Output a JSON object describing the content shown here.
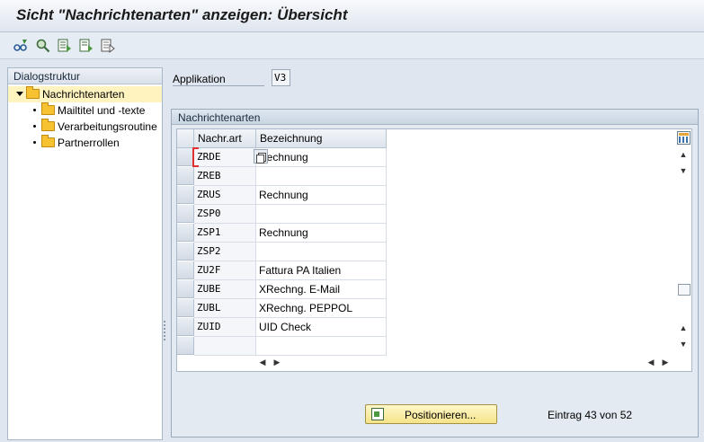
{
  "window": {
    "title": "Sicht \"Nachrichtenarten\" anzeigen: Übersicht"
  },
  "toolbar": {
    "icons": [
      "glasses-change-icon",
      "find-icon",
      "select-all-icon",
      "select-block-icon",
      "deselect-all-icon"
    ]
  },
  "dialog_structure": {
    "header": "Dialogstruktur",
    "items": [
      {
        "label": "Nachrichtenarten",
        "level": 0,
        "selected": true
      },
      {
        "label": "Mailtitel und -texte",
        "level": 1
      },
      {
        "label": "Verarbeitungsroutine",
        "level": 1
      },
      {
        "label": "Partnerrollen",
        "level": 1
      }
    ]
  },
  "application": {
    "label": "Applikation",
    "value": "V3"
  },
  "table": {
    "title": "Nachrichtenarten",
    "columns": [
      "Nachr.art",
      "Bezeichnung"
    ],
    "rows": [
      {
        "code": "ZRDE",
        "desc": "Rechnung"
      },
      {
        "code": "ZREB",
        "desc": ""
      },
      {
        "code": "ZRUS",
        "desc": "Rechnung"
      },
      {
        "code": "ZSP0",
        "desc": ""
      },
      {
        "code": "ZSP1",
        "desc": "Rechnung"
      },
      {
        "code": "ZSP2",
        "desc": ""
      },
      {
        "code": "ZU2F",
        "desc": "Fattura PA Italien"
      },
      {
        "code": "ZUBE",
        "desc": "XRechng. E-Mail"
      },
      {
        "code": "ZUBL",
        "desc": "XRechng. PEPPOL"
      },
      {
        "code": "ZUID",
        "desc": "UID Check"
      },
      {
        "code": "",
        "desc": ""
      }
    ]
  },
  "footer": {
    "position_button": "Positionieren...",
    "entry_text": "Eintrag 43 von 52"
  }
}
